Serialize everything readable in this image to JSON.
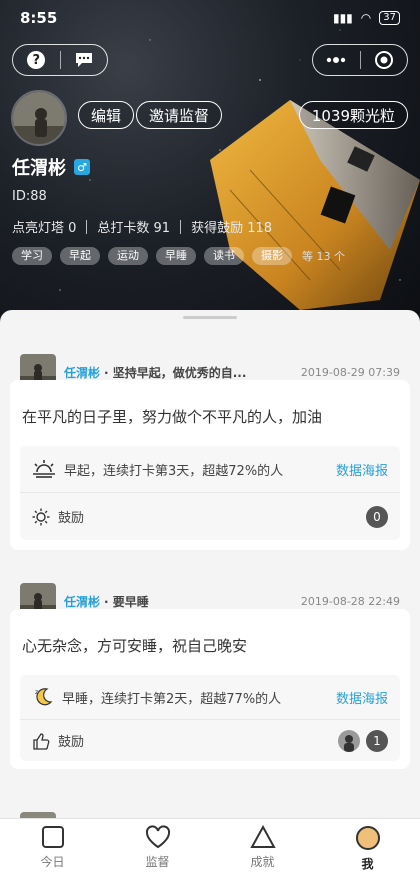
{
  "status": {
    "time": "8:55",
    "battery": "37"
  },
  "profile": {
    "name": "任渭彬",
    "gender_symbol": "♂",
    "id_label": "ID:88",
    "edit_label": "编辑",
    "invite_label": "邀请监督",
    "points_label": "1039颗光粒",
    "stats": [
      "点亮灯塔 0",
      "总打卡数 91",
      "获得鼓励 118"
    ],
    "tags": [
      "学习",
      "早起",
      "运动",
      "早睡",
      "读书",
      "摄影"
    ],
    "tags_more": "等 13 个"
  },
  "posts": [
    {
      "author": "任渭彬",
      "goal": "· 坚持早起，做优秀的自...",
      "time": "2019-08-29 07:39",
      "text": "在平凡的日子里，努力做个不平凡的人，加油",
      "checkin_text": "早起，连续打卡第3天，超越72%的人",
      "checkin_icon": "sunrise-icon",
      "poster_label": "数据海报",
      "cheer_label": "鼓励",
      "cheer_count": "0"
    },
    {
      "author": "任渭彬",
      "goal": "· 要早睡",
      "time": "2019-08-28 22:49",
      "text": "心无杂念，方可安睡，祝自己晚安",
      "checkin_text": "早睡，连续打卡第2天，超越77%的人",
      "checkin_icon": "moon-icon",
      "poster_label": "数据海报",
      "cheer_label": "鼓励",
      "cheer_count": "1"
    }
  ],
  "tabs": [
    {
      "label": "今日",
      "icon": "square-icon"
    },
    {
      "label": "监督",
      "icon": "heart-icon"
    },
    {
      "label": "成就",
      "icon": "triangle-icon"
    },
    {
      "label": "我",
      "icon": "circle-avatar-icon",
      "active": true
    }
  ],
  "colors": {
    "accent": "#29a0d8",
    "hero_bg": "#1c2027",
    "capsule": "#d99a2b"
  }
}
